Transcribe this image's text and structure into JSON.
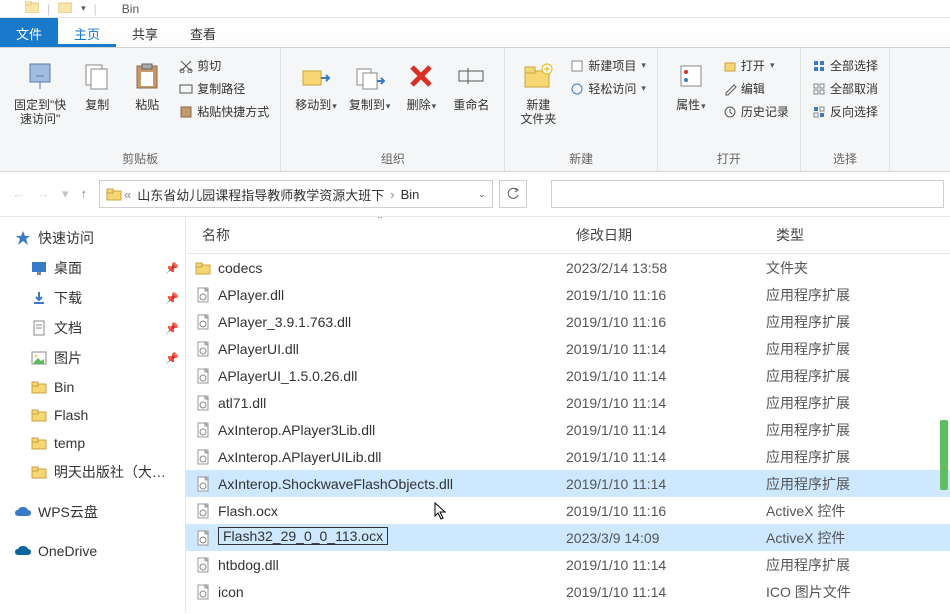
{
  "title_fragment": "Bin",
  "tabs": {
    "file": "文件",
    "home": "主页",
    "share": "共享",
    "view": "查看"
  },
  "ribbon": {
    "pin": {
      "line1": "固定到\"快",
      "line2": "速访问\""
    },
    "copy": "复制",
    "paste": "粘贴",
    "cut": "剪切",
    "copy_path": "复制路径",
    "paste_shortcut": "粘贴快捷方式",
    "clipboard_group": "剪贴板",
    "move_to": "移动到",
    "copy_to": "复制到",
    "delete": "删除",
    "rename": "重命名",
    "organize_group": "组织",
    "new_folder": "新建\n文件夹",
    "new_item": "新建项目",
    "easy_access": "轻松访问",
    "new_group": "新建",
    "properties": "属性",
    "open": "打开",
    "edit": "编辑",
    "history": "历史记录",
    "open_group": "打开",
    "select_all": "全部选择",
    "select_none": "全部取消",
    "invert_sel": "反向选择",
    "select_group": "选择"
  },
  "addr": {
    "crumb1": "山东省幼儿园课程指导教师教学资源大班下",
    "crumb2": "Bin"
  },
  "columns": {
    "name": "名称",
    "modified": "修改日期",
    "type": "类型"
  },
  "nav": {
    "quick_access": "快速访问",
    "desktop": "桌面",
    "downloads": "下载",
    "documents": "文档",
    "pictures": "图片",
    "bin": "Bin",
    "flash": "Flash",
    "temp": "temp",
    "publisher": "明天出版社（大班上",
    "wps": "WPS云盘",
    "onedrive": "OneDrive"
  },
  "files": [
    {
      "icon": "folder",
      "name": "codecs",
      "date": "2023/2/14 13:58",
      "type": "文件夹"
    },
    {
      "icon": "dll",
      "name": "APlayer.dll",
      "date": "2019/1/10 11:16",
      "type": "应用程序扩展"
    },
    {
      "icon": "dll",
      "name": "APlayer_3.9.1.763.dll",
      "date": "2019/1/10 11:16",
      "type": "应用程序扩展"
    },
    {
      "icon": "dll",
      "name": "APlayerUI.dll",
      "date": "2019/1/10 11:14",
      "type": "应用程序扩展"
    },
    {
      "icon": "dll",
      "name": "APlayerUI_1.5.0.26.dll",
      "date": "2019/1/10 11:14",
      "type": "应用程序扩展"
    },
    {
      "icon": "dll",
      "name": "atl71.dll",
      "date": "2019/1/10 11:14",
      "type": "应用程序扩展"
    },
    {
      "icon": "dll",
      "name": "AxInterop.APlayer3Lib.dll",
      "date": "2019/1/10 11:14",
      "type": "应用程序扩展"
    },
    {
      "icon": "dll",
      "name": "AxInterop.APlayerUILib.dll",
      "date": "2019/1/10 11:14",
      "type": "应用程序扩展"
    },
    {
      "icon": "dll",
      "name": "AxInterop.ShockwaveFlashObjects.dll",
      "date": "2019/1/10 11:14",
      "type": "应用程序扩展",
      "highlight": true
    },
    {
      "icon": "ocx",
      "name": "Flash.ocx",
      "date": "2019/1/10 11:16",
      "type": "ActiveX 控件"
    },
    {
      "icon": "ocx",
      "name": "Flash32_29_0_0_113.ocx",
      "date": "2023/3/9 14:09",
      "type": "ActiveX 控件",
      "selected": true,
      "boxed": true
    },
    {
      "icon": "dll",
      "name": "htbdog.dll",
      "date": "2019/1/10 11:14",
      "type": "应用程序扩展"
    },
    {
      "icon": "ico",
      "name": "icon",
      "date": "2019/1/10 11:14",
      "type": "ICO 图片文件"
    }
  ]
}
